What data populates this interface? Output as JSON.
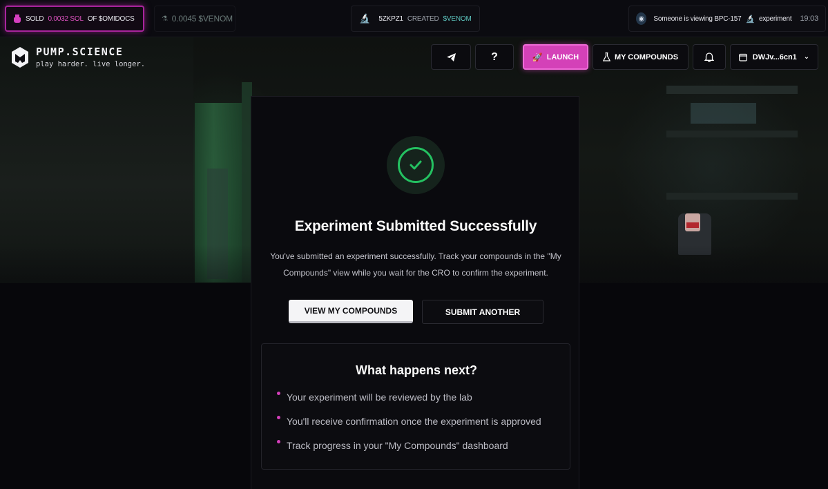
{
  "ticker": {
    "item1": {
      "action": "SOLD",
      "amount": "0.0032 SOL",
      "suffix": "OF $OMIDOCS"
    },
    "item2": {
      "amount": "0.0045 $VENOM"
    },
    "item3": {
      "user": "5ZKPZ1",
      "action": "CREATED",
      "token": "$VENOM"
    },
    "item4": {
      "text": "Someone is viewing BPC-157",
      "experiment": "experiment",
      "time": "19:03"
    }
  },
  "logo": {
    "title": "PUMP.SCIENCE",
    "tagline": "play harder. live longer."
  },
  "header": {
    "help": "?",
    "launch": "LAUNCH",
    "compounds": "MY COMPOUNDS",
    "wallet": "DWJv...6cn1"
  },
  "modal": {
    "title": "Experiment Submitted Successfully",
    "description": "You've submitted an experiment successfully. Track your compounds in the \"My Compounds\" view while you wait for the CRO to confirm the experiment.",
    "view_button": "VIEW MY COMPOUNDS",
    "submit_button": "SUBMIT ANOTHER",
    "next": {
      "title": "What happens next?",
      "items": [
        "Your experiment will be reviewed by the lab",
        "You'll receive confirmation once the experiment is approved",
        "Track progress in your \"My Compounds\" dashboard"
      ]
    }
  },
  "colors": {
    "accent": "#d441b8",
    "success": "#24c161",
    "background": "#07070b"
  }
}
